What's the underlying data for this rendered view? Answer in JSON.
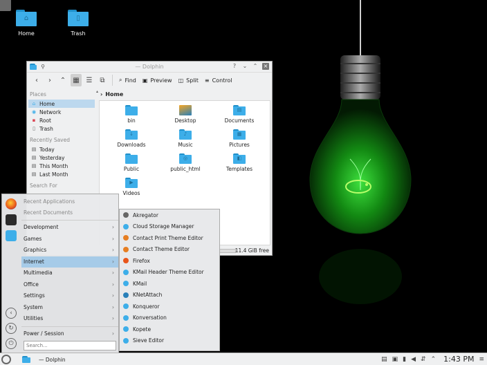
{
  "desktop": {
    "icons": [
      {
        "label": "Home",
        "glyph": "⌂"
      },
      {
        "label": "Trash",
        "glyph": "▯"
      }
    ]
  },
  "dolphin": {
    "title": "— Dolphin",
    "toolbar": {
      "find": "Find",
      "preview": "Preview",
      "split": "Split",
      "control": "Control"
    },
    "places": {
      "header": "Places",
      "items": [
        {
          "label": "Home",
          "icon": "home-icon"
        },
        {
          "label": "Network",
          "icon": "network-icon"
        },
        {
          "label": "Root",
          "icon": "root-icon"
        },
        {
          "label": "Trash",
          "icon": "trash-icon"
        }
      ],
      "recent_header": "Recently Saved",
      "recent": [
        "Today",
        "Yesterday",
        "This Month",
        "Last Month"
      ],
      "search_header": "Search For"
    },
    "breadcrumb": "Home",
    "files": [
      {
        "name": "bin",
        "icon": "folder-icon"
      },
      {
        "name": "Desktop",
        "icon": "desktop-folder-icon"
      },
      {
        "name": "Documents",
        "icon": "documents-folder-icon"
      },
      {
        "name": "Downloads",
        "icon": "downloads-folder-icon"
      },
      {
        "name": "Music",
        "icon": "music-folder-icon"
      },
      {
        "name": "Pictures",
        "icon": "pictures-folder-icon"
      },
      {
        "name": "Public",
        "icon": "folder-icon"
      },
      {
        "name": "public_html",
        "icon": "public-html-folder-icon"
      },
      {
        "name": "Templates",
        "icon": "templates-folder-icon"
      },
      {
        "name": "Videos",
        "icon": "videos-folder-icon"
      }
    ],
    "free_space": "11.4 GiB free"
  },
  "launcher": {
    "recent_apps": "Recent Applications",
    "recent_docs": "Recent Documents",
    "categories": [
      "Development",
      "Games",
      "Graphics",
      "Internet",
      "Multimedia",
      "Office",
      "Settings",
      "System",
      "Utilities",
      "Power / Session"
    ],
    "selected": "Internet",
    "search_placeholder": "Search..."
  },
  "internet_submenu": [
    "Akregator",
    "Cloud Storage Manager",
    "Contact Print Theme Editor",
    "Contact Theme Editor",
    "Firefox",
    "KMail Header Theme Editor",
    "KMail",
    "KNetAttach",
    "Konqueror",
    "Konversation",
    "Kopete",
    "Sieve Editor"
  ],
  "panel": {
    "task_title": "— Dolphin",
    "clock": "1:43 PM"
  },
  "colors": {
    "accent": "#3daee9",
    "selection": "#a6cbe8",
    "bulb_glow": "#2ecc2e"
  }
}
